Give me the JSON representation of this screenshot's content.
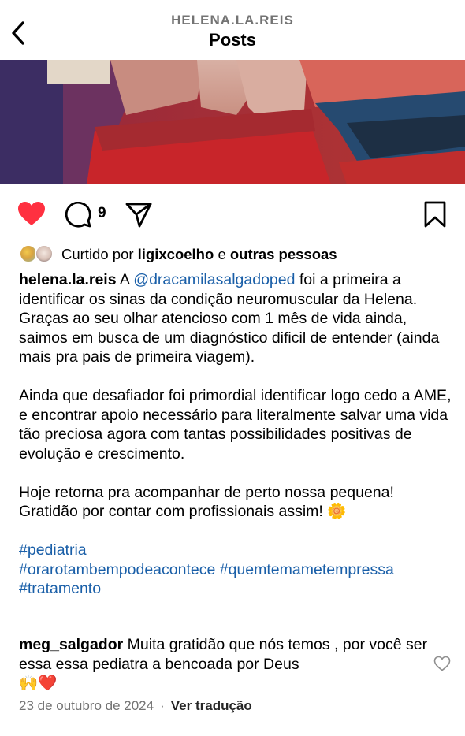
{
  "header": {
    "username": "HELENA.LA.REIS",
    "title": "Posts"
  },
  "actions": {
    "comment_count": "9"
  },
  "likes": {
    "prefix": "Curtido por",
    "user": "ligixcoelho",
    "connector": "e",
    "others": "outras pessoas"
  },
  "caption": {
    "author": "helena.la.reis",
    "p1_start": "A",
    "mention": "@dracamilasalgadoped",
    "p1_rest": "foi a primeira a identificar os sinas da condição neuromuscular da Helena. Graças ao seu olhar atencioso com 1 mês de vida ainda, saimos em busca de um diagnóstico dificil de entender (ainda mais pra pais de primeira viagem).",
    "p2": "Ainda que desafiador foi primordial identificar logo cedo a AME, e encontrar apoio necessário para literalmente salvar uma vida tão preciosa agora com tantas possibilidades positivas de evolução e crescimento.",
    "p3": "Hoje retorna pra acompanhar de perto nossa pequena! Gratidão por contar com profissionais assim!",
    "p3_emoji": "🌼",
    "hashtags": [
      "#pediatria",
      "#orarotambempodeacontece",
      "#quemtemametempressa",
      "#tratamento"
    ]
  },
  "comment": {
    "author": "meg_salgador",
    "text": "Muita gratidão que nós temos , por você ser essa essa pediatra a bencoada por Deus",
    "emojis": "🙌❤️"
  },
  "footer": {
    "date": "23 de outubro de 2024",
    "separator": "·",
    "translate": "Ver tradução"
  },
  "colors": {
    "like_red": "#ff3040",
    "link_blue": "#1a5fa8",
    "muted": "#737373"
  },
  "icons": [
    "back-arrow-icon",
    "heart-filled-icon",
    "comment-icon",
    "share-icon",
    "bookmark-icon",
    "comment-heart-icon"
  ]
}
